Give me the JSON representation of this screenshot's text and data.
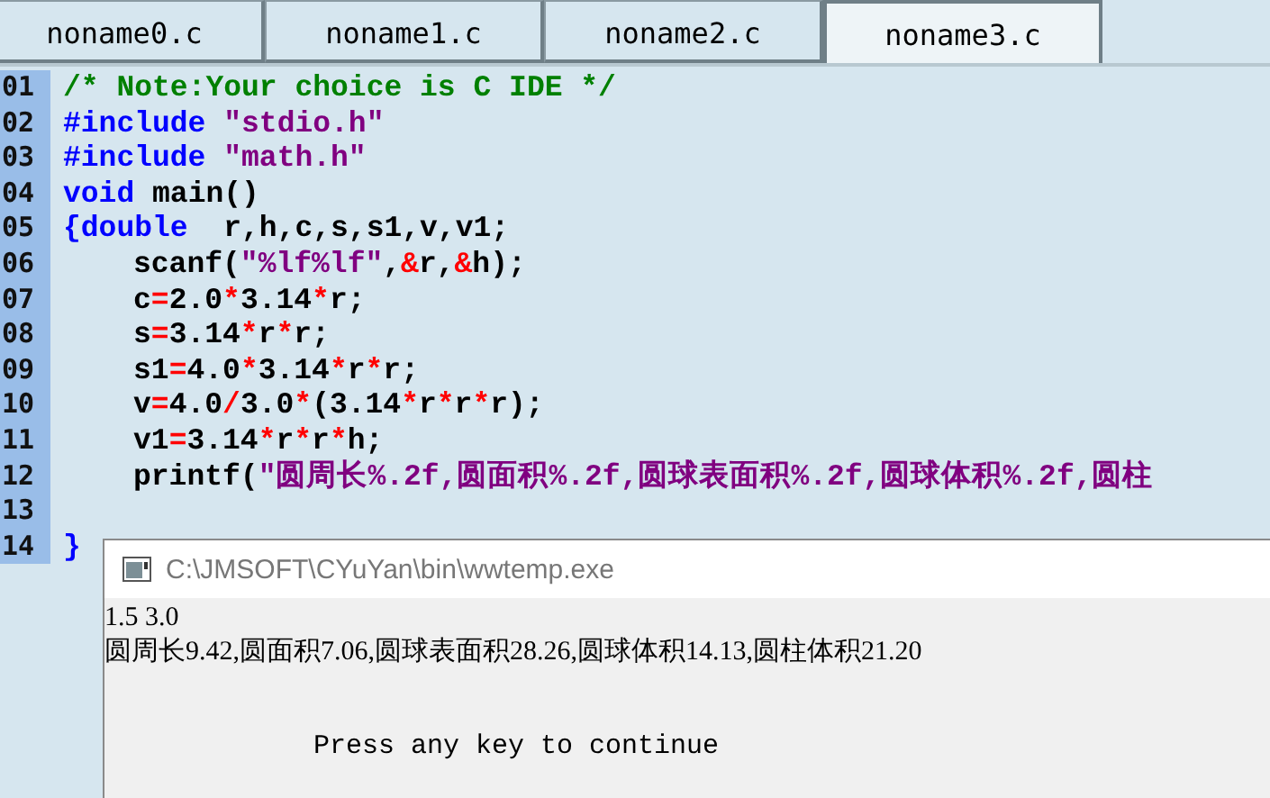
{
  "tabs": [
    {
      "label": "noname0.c",
      "selected": false
    },
    {
      "label": "noname1.c",
      "selected": false
    },
    {
      "label": "noname2.c",
      "selected": false
    },
    {
      "label": "noname3.c",
      "selected": true
    }
  ],
  "editor": {
    "lines": [
      {
        "number": "01",
        "indented": false,
        "tokens": [
          {
            "kind": "comment",
            "text": "/* Note:Your choice is C IDE */"
          }
        ]
      },
      {
        "number": "02",
        "indented": false,
        "tokens": [
          {
            "kind": "keyword",
            "text": "#include "
          },
          {
            "kind": "string",
            "text": "\"stdio.h\""
          }
        ]
      },
      {
        "number": "03",
        "indented": false,
        "tokens": [
          {
            "kind": "keyword",
            "text": "#include "
          },
          {
            "kind": "string",
            "text": "\"math.h\""
          }
        ]
      },
      {
        "number": "04",
        "indented": false,
        "tokens": [
          {
            "kind": "keyword",
            "text": "void"
          },
          {
            "kind": "plain",
            "text": " main()"
          }
        ]
      },
      {
        "number": "05",
        "indented": false,
        "tokens": [
          {
            "kind": "keyword",
            "text": "{double"
          },
          {
            "kind": "plain",
            "text": "  r,h,c,s,s1,v,v1;"
          }
        ]
      },
      {
        "number": "06",
        "indented": true,
        "tokens": [
          {
            "kind": "plain",
            "text": "scanf("
          },
          {
            "kind": "string",
            "text": "\"%lf%lf\""
          },
          {
            "kind": "plain",
            "text": ","
          },
          {
            "kind": "operator",
            "text": "&"
          },
          {
            "kind": "plain",
            "text": "r,"
          },
          {
            "kind": "operator",
            "text": "&"
          },
          {
            "kind": "plain",
            "text": "h);"
          }
        ]
      },
      {
        "number": "07",
        "indented": true,
        "tokens": [
          {
            "kind": "plain",
            "text": "c"
          },
          {
            "kind": "operator",
            "text": "="
          },
          {
            "kind": "plain",
            "text": "2.0"
          },
          {
            "kind": "operator",
            "text": "*"
          },
          {
            "kind": "plain",
            "text": "3.14"
          },
          {
            "kind": "operator",
            "text": "*"
          },
          {
            "kind": "plain",
            "text": "r;"
          }
        ]
      },
      {
        "number": "08",
        "indented": true,
        "tokens": [
          {
            "kind": "plain",
            "text": "s"
          },
          {
            "kind": "operator",
            "text": "="
          },
          {
            "kind": "plain",
            "text": "3.14"
          },
          {
            "kind": "operator",
            "text": "*"
          },
          {
            "kind": "plain",
            "text": "r"
          },
          {
            "kind": "operator",
            "text": "*"
          },
          {
            "kind": "plain",
            "text": "r;"
          }
        ]
      },
      {
        "number": "09",
        "indented": true,
        "tokens": [
          {
            "kind": "plain",
            "text": "s1"
          },
          {
            "kind": "operator",
            "text": "="
          },
          {
            "kind": "plain",
            "text": "4.0"
          },
          {
            "kind": "operator",
            "text": "*"
          },
          {
            "kind": "plain",
            "text": "3.14"
          },
          {
            "kind": "operator",
            "text": "*"
          },
          {
            "kind": "plain",
            "text": "r"
          },
          {
            "kind": "operator",
            "text": "*"
          },
          {
            "kind": "plain",
            "text": "r;"
          }
        ]
      },
      {
        "number": "10",
        "indented": true,
        "tokens": [
          {
            "kind": "plain",
            "text": "v"
          },
          {
            "kind": "operator",
            "text": "="
          },
          {
            "kind": "plain",
            "text": "4.0"
          },
          {
            "kind": "operator",
            "text": "/"
          },
          {
            "kind": "plain",
            "text": "3.0"
          },
          {
            "kind": "operator",
            "text": "*"
          },
          {
            "kind": "plain",
            "text": "(3.14"
          },
          {
            "kind": "operator",
            "text": "*"
          },
          {
            "kind": "plain",
            "text": "r"
          },
          {
            "kind": "operator",
            "text": "*"
          },
          {
            "kind": "plain",
            "text": "r"
          },
          {
            "kind": "operator",
            "text": "*"
          },
          {
            "kind": "plain",
            "text": "r);"
          }
        ]
      },
      {
        "number": "11",
        "indented": true,
        "tokens": [
          {
            "kind": "plain",
            "text": "v1"
          },
          {
            "kind": "operator",
            "text": "="
          },
          {
            "kind": "plain",
            "text": "3.14"
          },
          {
            "kind": "operator",
            "text": "*"
          },
          {
            "kind": "plain",
            "text": "r"
          },
          {
            "kind": "operator",
            "text": "*"
          },
          {
            "kind": "plain",
            "text": "r"
          },
          {
            "kind": "operator",
            "text": "*"
          },
          {
            "kind": "plain",
            "text": "h;"
          }
        ]
      },
      {
        "number": "12",
        "indented": true,
        "tokens": [
          {
            "kind": "plain",
            "text": "printf("
          },
          {
            "kind": "string",
            "text": "\"圆周长%.2f,圆面积%.2f,圆球表面积%.2f,圆球体积%.2f,圆柱"
          }
        ]
      },
      {
        "number": "13"
      },
      {
        "number": "14",
        "indented": false,
        "tokens": [
          {
            "kind": "keyword",
            "text": "}"
          }
        ]
      }
    ]
  },
  "console": {
    "title": "C:\\JMSOFT\\CYuYan\\bin\\wwtemp.exe",
    "lines": [
      "1.5 3.0",
      "圆周长9.42,圆面积7.06,圆球表面积28.26,圆球体积14.13,圆柱体积21.20"
    ],
    "prompt": "Press any key to continue"
  }
}
